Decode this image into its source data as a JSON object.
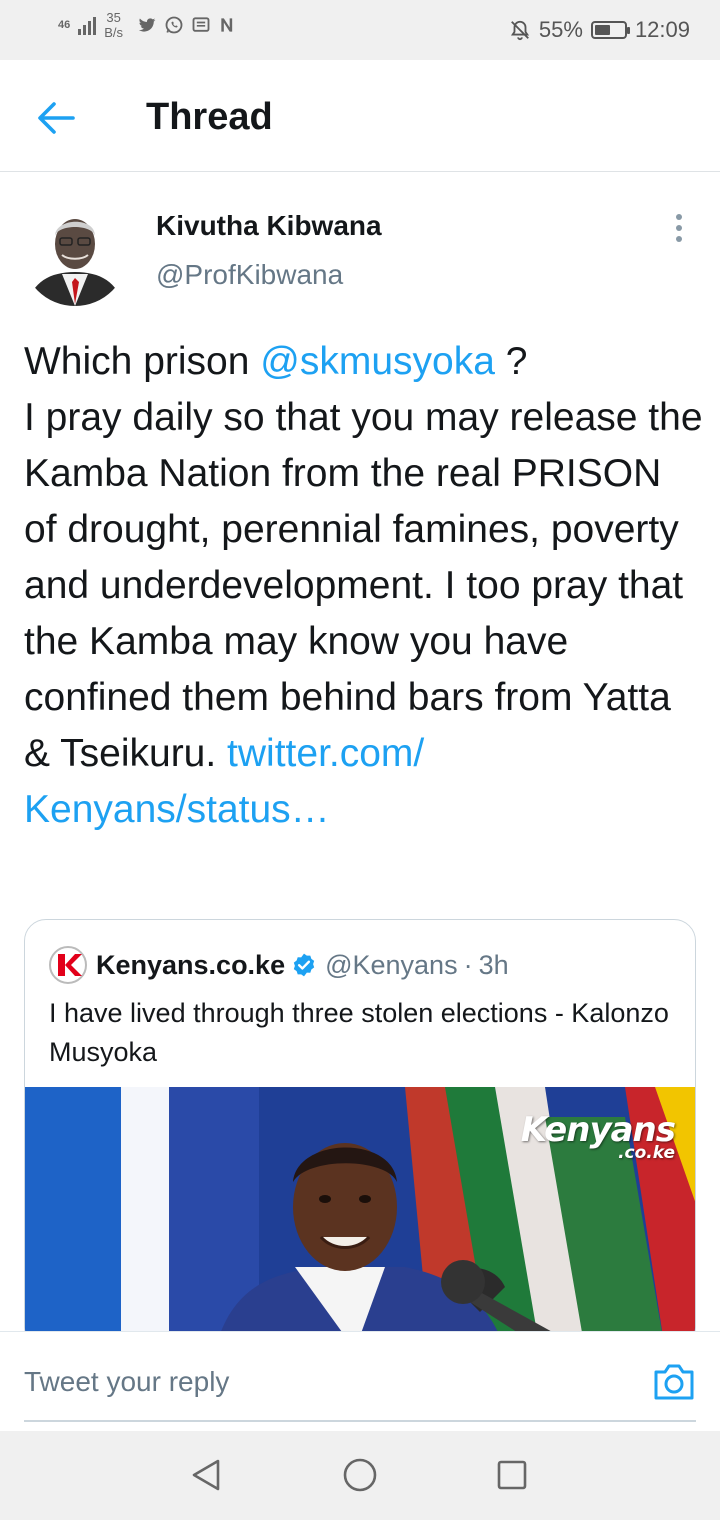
{
  "status_bar": {
    "network": "4G",
    "network_sub": "46",
    "speed_value": "35",
    "speed_unit": "B/s",
    "battery": "55%",
    "battery_level": 0.55,
    "time": "12:09"
  },
  "header": {
    "title": "Thread"
  },
  "tweet": {
    "author_name": "Kivutha Kibwana",
    "author_handle": "@ProfKibwana",
    "text_1": "Which prison ",
    "mention": "@skmusyoka",
    "text_2": " ?\nI  pray daily so that you may release the Kamba Nation from the real PRISON of drought, perennial famines, poverty and underdevelopment. I too pray that the Kamba may know you have confined them behind bars from Yatta & Tseikuru. ",
    "link": "twitter.com/\nKenyans/status…"
  },
  "quoted_tweet": {
    "name": "Kenyans.co.ke",
    "handle": "@Kenyans",
    "separator": "·",
    "time": "3h",
    "text": "I have lived through three stolen elections - Kalonzo Musyoka",
    "watermark_main": "Kenyans",
    "watermark_sub": ".co.ke"
  },
  "reply": {
    "placeholder": "Tweet your reply"
  },
  "colors": {
    "accent": "#1da1f2",
    "text": "#14171a",
    "secondary": "#657786",
    "verified": "#1da1f2",
    "brand_red": "#e2001a"
  },
  "icons": {
    "back": "arrow-left-icon",
    "more": "vertical-ellipsis-icon",
    "verified": "verified-badge-icon",
    "camera": "camera-icon",
    "nav_back": "triangle-back-icon",
    "nav_home": "circle-home-icon",
    "nav_recents": "square-recents-icon"
  }
}
